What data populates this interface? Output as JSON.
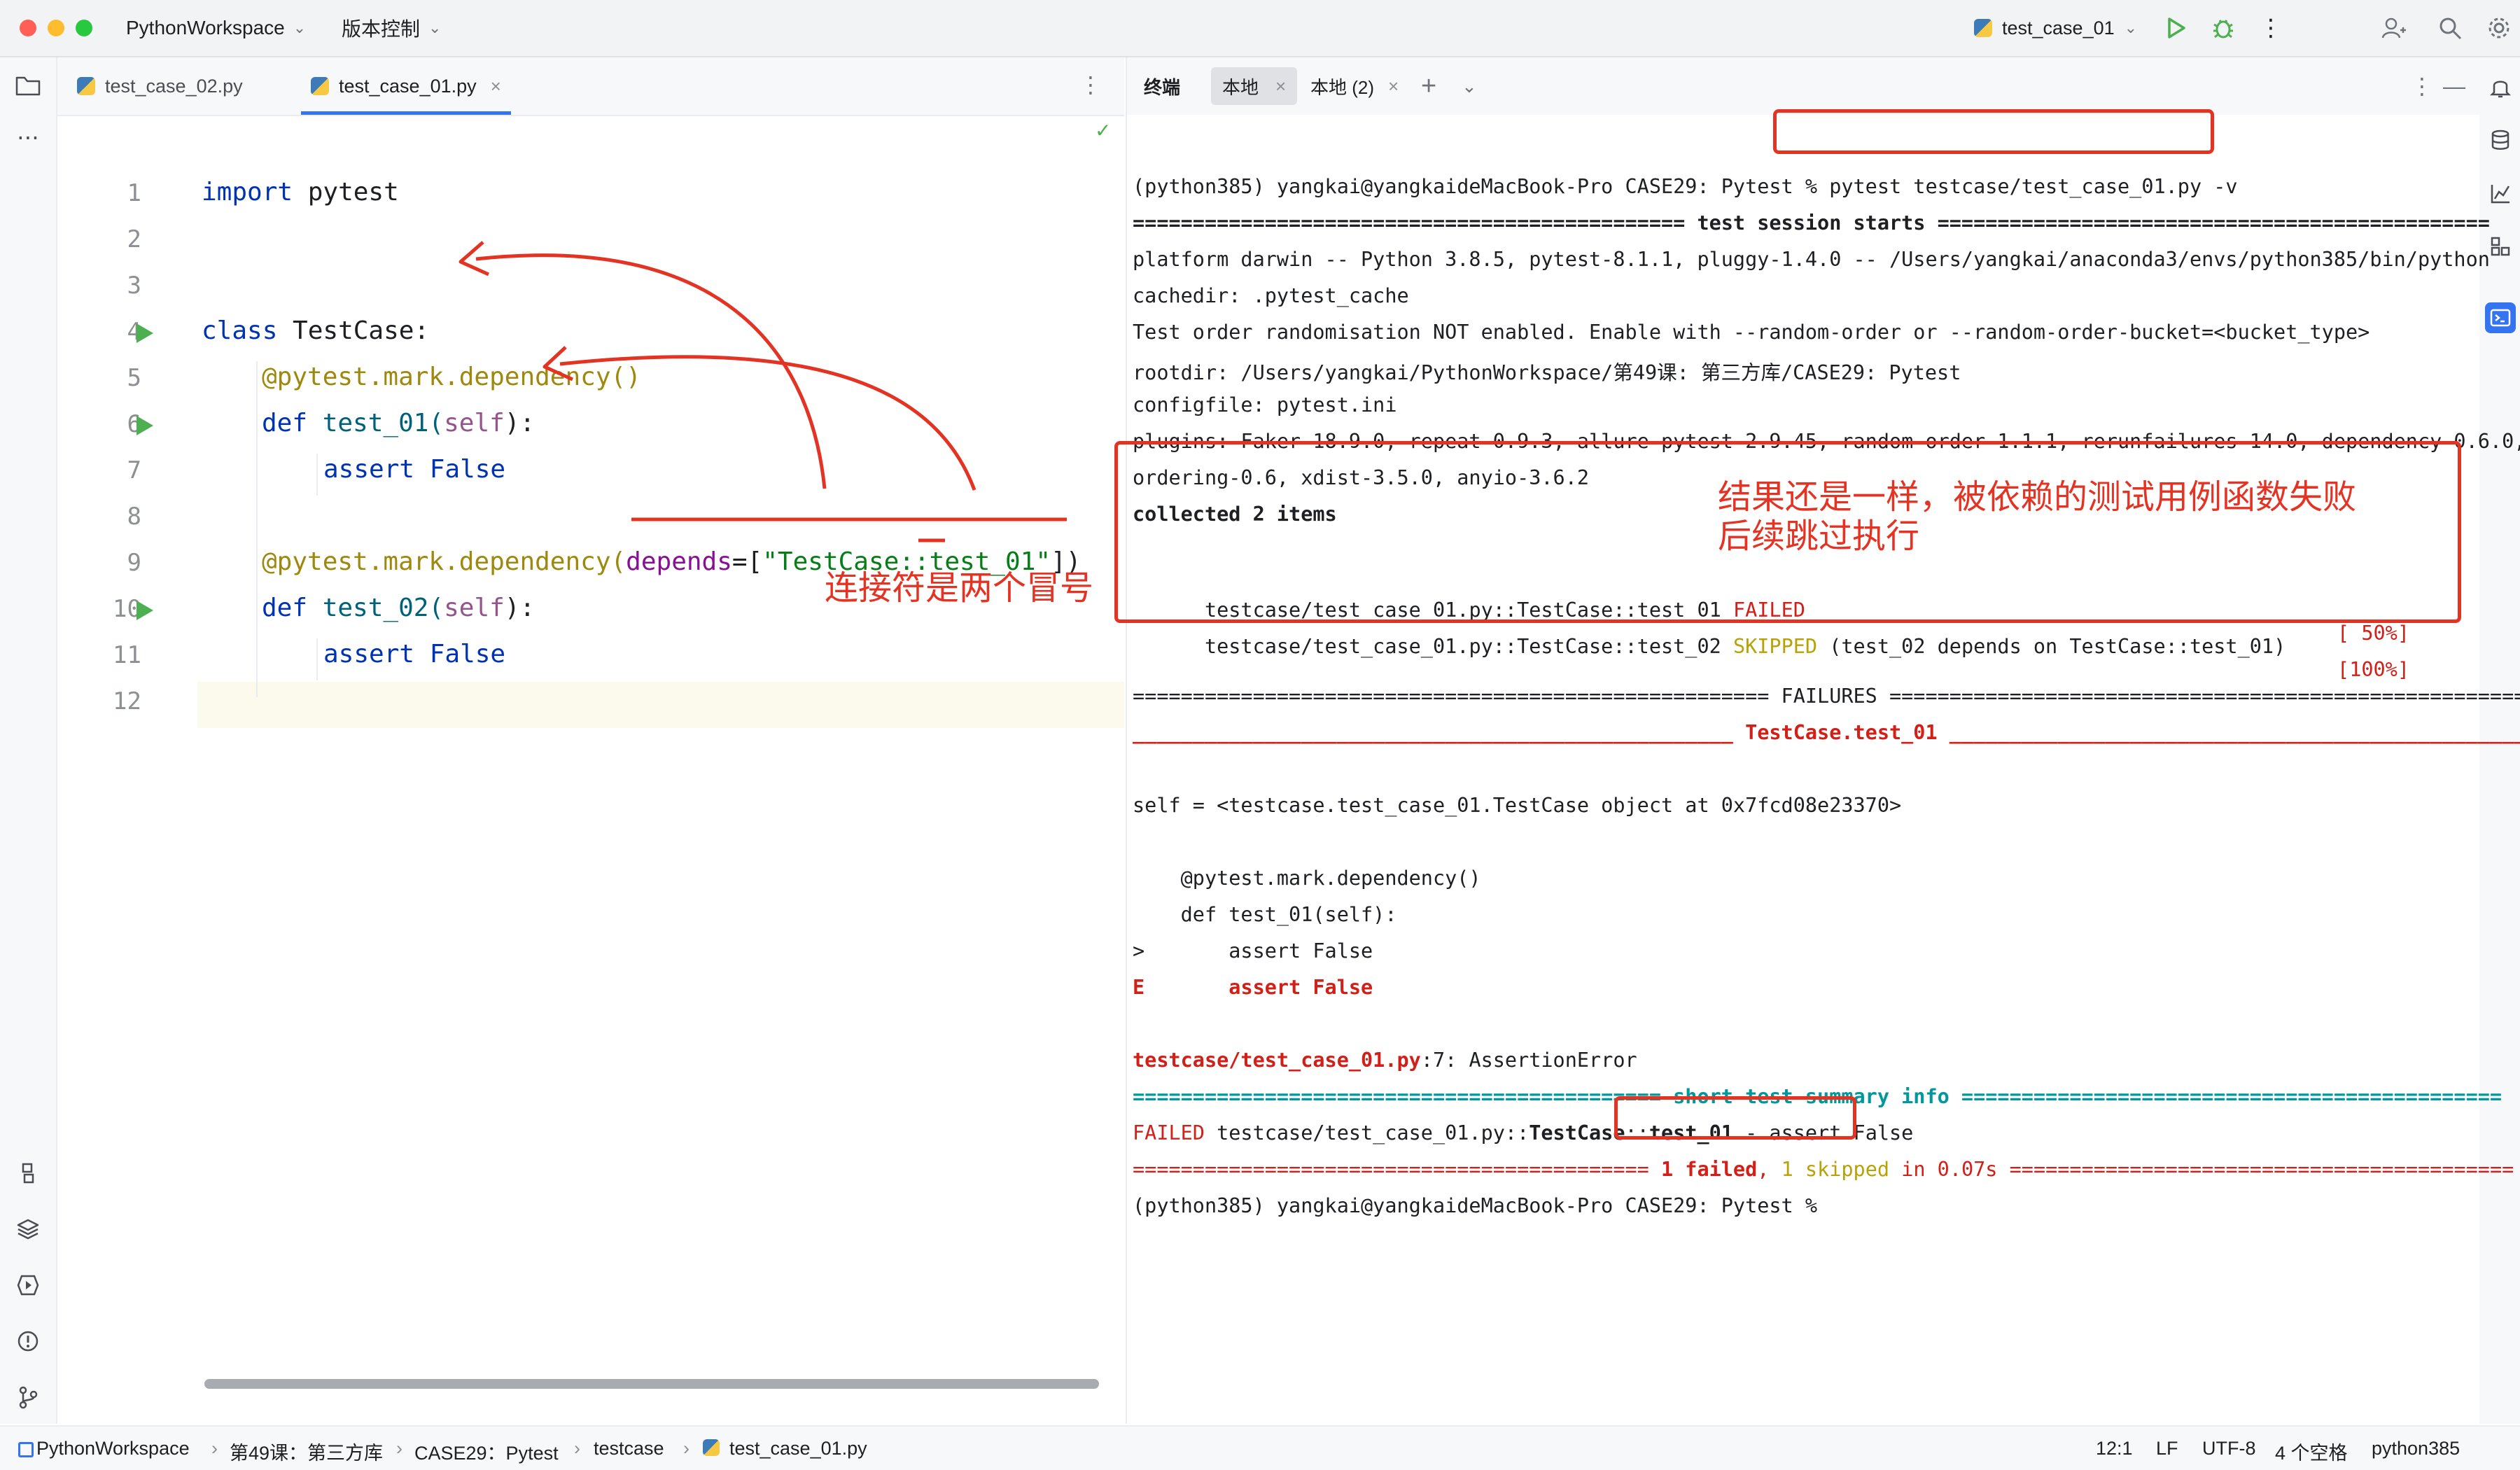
{
  "titlebar": {
    "project": "PythonWorkspace",
    "vcs": "版本控制",
    "run_config": "test_case_01"
  },
  "editor": {
    "tabs": [
      {
        "label": "test_case_02.py"
      },
      {
        "label": "test_case_01.py"
      }
    ],
    "line_numbers": [
      "1",
      "2",
      "3",
      "4",
      "5",
      "6",
      "7",
      "8",
      "9",
      "10",
      "11",
      "12"
    ],
    "code": {
      "l1_kw": "import",
      "l1_rest": " pytest",
      "l4_kw": "class",
      "l4_rest": " TestCase:",
      "l5": "@pytest.mark.dependency()",
      "l6_kw": "def",
      "l6_fn": " test_01(",
      "l6_self": "self",
      "l6_end": "):",
      "l7_kw": "assert",
      "l7_val": " False",
      "l9_deco": "@pytest.mark.dependency(",
      "l9_param": "depends",
      "l9_eq": "=[",
      "l9_str": "\"TestCase::test_01\"",
      "l9_end": "])",
      "l10_kw": "def",
      "l10_fn": " test_02(",
      "l10_self": "self",
      "l10_end": "):",
      "l11_kw": "assert",
      "l11_val": " False"
    }
  },
  "terminal": {
    "tabs": [
      {
        "label": "终端"
      },
      {
        "label": "本地"
      },
      {
        "label": "本地 (2)"
      }
    ],
    "lines": {
      "prompt1": "(python385) yangkai@yangkaideMacBook-Pro CASE29: Pytest % ",
      "cmd1": "pytest testcase/test_case_01.py -v",
      "session": "============================================== test session starts ==============================================",
      "platform": "platform darwin -- Python 3.8.5, pytest-8.1.1, pluggy-1.4.0 -- /Users/yangkai/anaconda3/envs/python385/bin/python",
      "cachedir": "cachedir: .pytest_cache",
      "order": "Test order randomisation NOT enabled. Enable with --random-order or --random-order-bucket=<bucket_type>",
      "rootdir": "rootdir: /Users/yangkai/PythonWorkspace/第49课: 第三方库/CASE29: Pytest",
      "configfile": "configfile: pytest.ini",
      "plugins1": "plugins: Faker-18.9.0, repeat-0.9.3, allure-pytest-2.9.45, random-order-1.1.1, rerunfailures-14.0, dependency-0.6.0,",
      "plugins2": "ordering-0.6, xdist-3.5.0, anyio-3.6.2",
      "collected": "collected 2 items",
      "t1_name": "testcase/test_case_01.py::TestCase::test_01 ",
      "t1_status": "FAILED",
      "t1_pct": "[ 50%]",
      "t2_name": "testcase/test_case_01.py::TestCase::test_02 ",
      "t2_status": "SKIPPED",
      "t2_reason": " (test_02 depends on TestCase::test_01)",
      "t2_pct": "[100%]",
      "failures": "===================================================== FAILURES =====================================================",
      "tc_header": "__________________________________________________ TestCase.test_01 ___________________________________________________",
      "self_obj": "self = <testcase.test_case_01.TestCase object at 0x7fcd08e23370>",
      "src1": "    @pytest.mark.dependency()",
      "src2": "    def test_01(self):",
      "src3": ">       assert False",
      "src4_e": "E",
      "src4": "       assert False",
      "loc_file": "testcase/test_case_01.py",
      "loc_rest": ":7: AssertionError",
      "summary": "============================================ short test summary info =============================================",
      "failed_lbl": "FAILED",
      "failed_path": " testcase/test_case_01.py::",
      "failed_bold": "TestCase",
      "failed_sep": "::",
      "failed_fn": "test_01",
      "failed_rest": " - assert False",
      "final_left": "=========================================== ",
      "final_failed": "1 failed",
      "final_comma": ", ",
      "final_skipped": "1 skipped",
      "final_time": " in 0.07s",
      "final_right": " ==========================================",
      "prompt2": "(python385) yangkai@yangkaideMacBook-Pro CASE29: Pytest % "
    }
  },
  "annotations": {
    "colon_note": "连接符是两个冒号",
    "result_note1": "结果还是一样，被依赖的测试用例函数失败",
    "result_note2": "后续跳过执行"
  },
  "statusbar": {
    "crumbs": [
      "PythonWorkspace",
      "第49课：第三方库",
      "CASE29：Pytest",
      "testcase",
      "test_case_01.py"
    ],
    "position": "12:1",
    "line_sep": "LF",
    "encoding": "UTF-8",
    "indent": "4 个空格",
    "interpreter": "python385"
  },
  "colors": {
    "annotation": "#e53323",
    "keyword": "#0033b3",
    "decorator": "#9e880d",
    "string": "#067d17",
    "failed": "#d21f18",
    "skipped": "#b8a206",
    "run_icon": "#4caf50"
  }
}
